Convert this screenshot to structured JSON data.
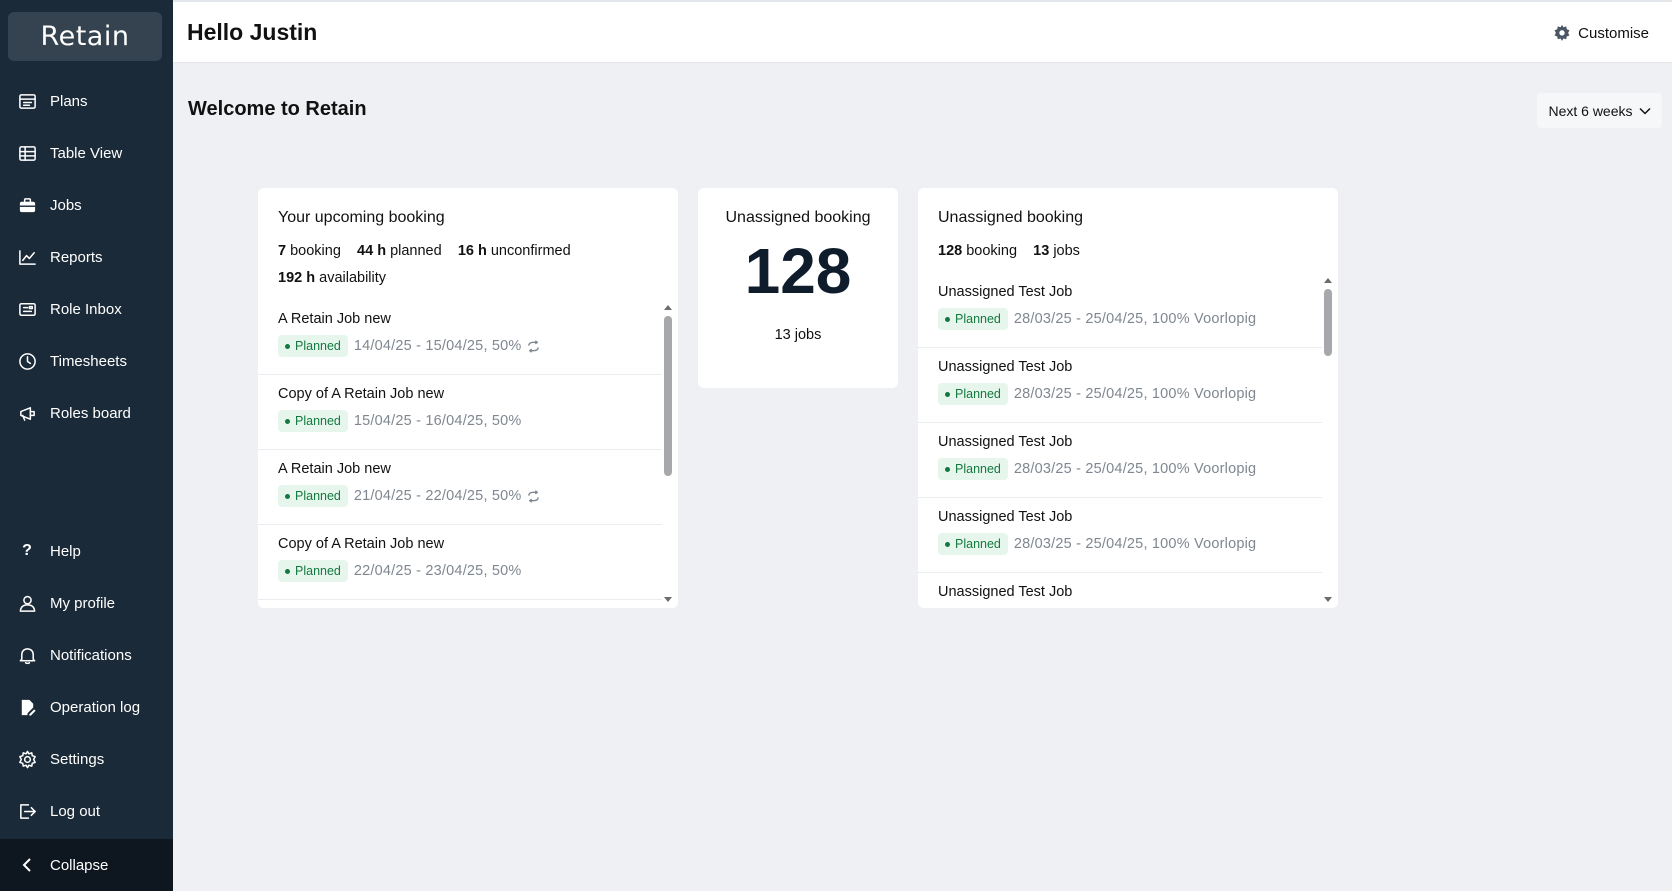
{
  "app": {
    "logo_text": "Retain",
    "brand_color": "#1b2a38",
    "accent_color": "#3ad07a"
  },
  "sidebar": {
    "items": [
      {
        "label": "Plans",
        "icon": "plans-icon"
      },
      {
        "label": "Table View",
        "icon": "table-icon"
      },
      {
        "label": "Jobs",
        "icon": "briefcase-icon"
      },
      {
        "label": "Reports",
        "icon": "chart-line-icon"
      },
      {
        "label": "Role Inbox",
        "icon": "inbox-icon"
      },
      {
        "label": "Timesheets",
        "icon": "clock-icon"
      },
      {
        "label": "Roles board",
        "icon": "megaphone-icon"
      }
    ],
    "bottom_items": [
      {
        "label": "Help",
        "icon": "question-icon"
      },
      {
        "label": "My profile",
        "icon": "user-icon"
      },
      {
        "label": "Notifications",
        "icon": "bell-icon"
      },
      {
        "label": "Operation log",
        "icon": "file-edit-icon"
      },
      {
        "label": "Settings",
        "icon": "gear-icon"
      },
      {
        "label": "Log out",
        "icon": "logout-icon"
      }
    ],
    "collapse_label": "Collapse"
  },
  "header": {
    "greeting": "Hello Justin",
    "customise_label": "Customise"
  },
  "main": {
    "welcome": "Welcome to Retain",
    "range_label": "Next 6 weeks"
  },
  "upcoming": {
    "title": "Your upcoming booking",
    "stats": {
      "booking_count": "7",
      "booking_word": "booking",
      "planned_hours": "44 h",
      "planned_word": "planned",
      "unconfirmed_hours": "16 h",
      "unconfirmed_word": "unconfirmed",
      "availability_hours": "192 h",
      "availability_word": "availability"
    },
    "items": [
      {
        "title": "A Retain Job new",
        "status": "Planned",
        "dates": "14/04/25 - 15/04/25, 50%",
        "repeat": true
      },
      {
        "title": "Copy of A Retain Job new",
        "status": "Planned",
        "dates": "15/04/25 - 16/04/25, 50%",
        "repeat": false
      },
      {
        "title": "A Retain Job new",
        "status": "Planned",
        "dates": "21/04/25 - 22/04/25, 50%",
        "repeat": true
      },
      {
        "title": "Copy of A Retain Job new",
        "status": "Planned",
        "dates": "22/04/25 - 23/04/25, 50%",
        "repeat": false
      }
    ]
  },
  "unassigned_summary": {
    "title": "Unassigned booking",
    "count": "128",
    "jobs": "13 jobs"
  },
  "unassigned_list": {
    "title": "Unassigned booking",
    "stats": {
      "booking_count": "128",
      "booking_word": "booking",
      "jobs_count": "13",
      "jobs_word": "jobs"
    },
    "items": [
      {
        "title": "Unassigned Test Job",
        "status": "Planned",
        "dates": "28/03/25 - 25/04/25, 100% Voorlopig"
      },
      {
        "title": "Unassigned Test Job",
        "status": "Planned",
        "dates": "28/03/25 - 25/04/25, 100% Voorlopig"
      },
      {
        "title": "Unassigned Test Job",
        "status": "Planned",
        "dates": "28/03/25 - 25/04/25, 100% Voorlopig"
      },
      {
        "title": "Unassigned Test Job",
        "status": "Planned",
        "dates": "28/03/25 - 25/04/25, 100% Voorlopig"
      },
      {
        "title": "Unassigned Test Job",
        "status": "",
        "dates": ""
      }
    ]
  }
}
